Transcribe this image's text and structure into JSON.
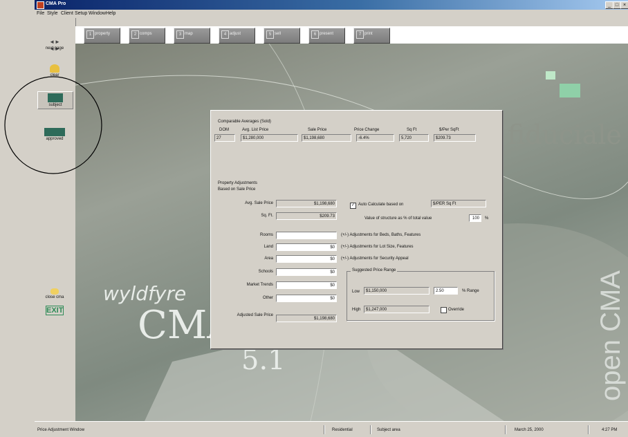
{
  "window": {
    "title": "CMA Pro",
    "min": "_",
    "max": "□",
    "close": "×"
  },
  "menu": [
    "File",
    "Style",
    "Client",
    "Setup",
    "Window",
    "Help"
  ],
  "left_buttons": [
    {
      "label": "next page"
    },
    {
      "label": "clear"
    },
    {
      "label": "subject"
    },
    {
      "label": "approved"
    },
    {
      "label": "close cma"
    },
    {
      "label": "EXIT"
    }
  ],
  "tabs": [
    {
      "num": "1",
      "label": "property"
    },
    {
      "num": "2",
      "label": "comps"
    },
    {
      "num": "3",
      "label": "map"
    },
    {
      "num": "4",
      "label": "adjust"
    },
    {
      "num": "5",
      "label": "sell"
    },
    {
      "num": "6",
      "label": "present"
    },
    {
      "num": "7",
      "label": "print"
    }
  ],
  "background": {
    "brand": "wyldfyre",
    "product": "CMA",
    "version": "5.1",
    "side_text": "open CMA",
    "faint_text": "fiduciale"
  },
  "averages": {
    "title": "Comparable Averages (Sold)",
    "headers": [
      "DOM",
      "Avg. List Price",
      "Sale Price",
      "Price Change",
      "Sq Ft",
      "$/Per SqFt"
    ],
    "values": [
      "27",
      "$1,280,000",
      "$1,198,680",
      "-6.4%",
      "5,720",
      "$209.73"
    ]
  },
  "adjustments": {
    "title": "Property Adjustments",
    "subtitle": "Based on Sale Price",
    "rows": [
      {
        "label": "Avg. Sale Price",
        "value": "$1,198,680"
      },
      {
        "label": "Sq. Ft.",
        "value": "$209.73"
      },
      {
        "label": "Rooms",
        "value": ""
      },
      {
        "label": "Land",
        "value": "$0"
      },
      {
        "label": "Area",
        "value": "$0"
      },
      {
        "label": "Schools",
        "value": "$0"
      },
      {
        "label": "Market Trends",
        "value": "$0"
      },
      {
        "label": "Other",
        "value": "$0"
      }
    ],
    "adjusted_label": "Adjusted Sale Price",
    "adjusted_value": "$1,198,680",
    "auto_calc_label": "Auto Calculate based on",
    "auto_calc_value": "$/PER Sq Ft",
    "value_of_structure_label": "Value of structure as % of total value",
    "value_of_structure_value": "100",
    "pct": "%",
    "notes": [
      "(+/-) Adjustments for Beds, Baths, Features",
      "(+/-) Adjustments for Lot Size, Features",
      "(+/-) Adjustments for Security Appeal"
    ]
  },
  "price_range": {
    "title": "Suggested Price Range",
    "low_label": "Low",
    "low_value": "$1,150,000",
    "pct_value": "2.50",
    "range_label": "% Range",
    "high_label": "High",
    "high_value": "$1,247,000",
    "override_label": "Override"
  },
  "status": {
    "left": "Price Adjustment Window",
    "mode": "Residential",
    "subject": "Subject area",
    "date": "March 25, 2000",
    "time": "4:27 PM"
  },
  "colors": {
    "titlebar": "#0a246a",
    "panel": "#d4d0c8"
  }
}
